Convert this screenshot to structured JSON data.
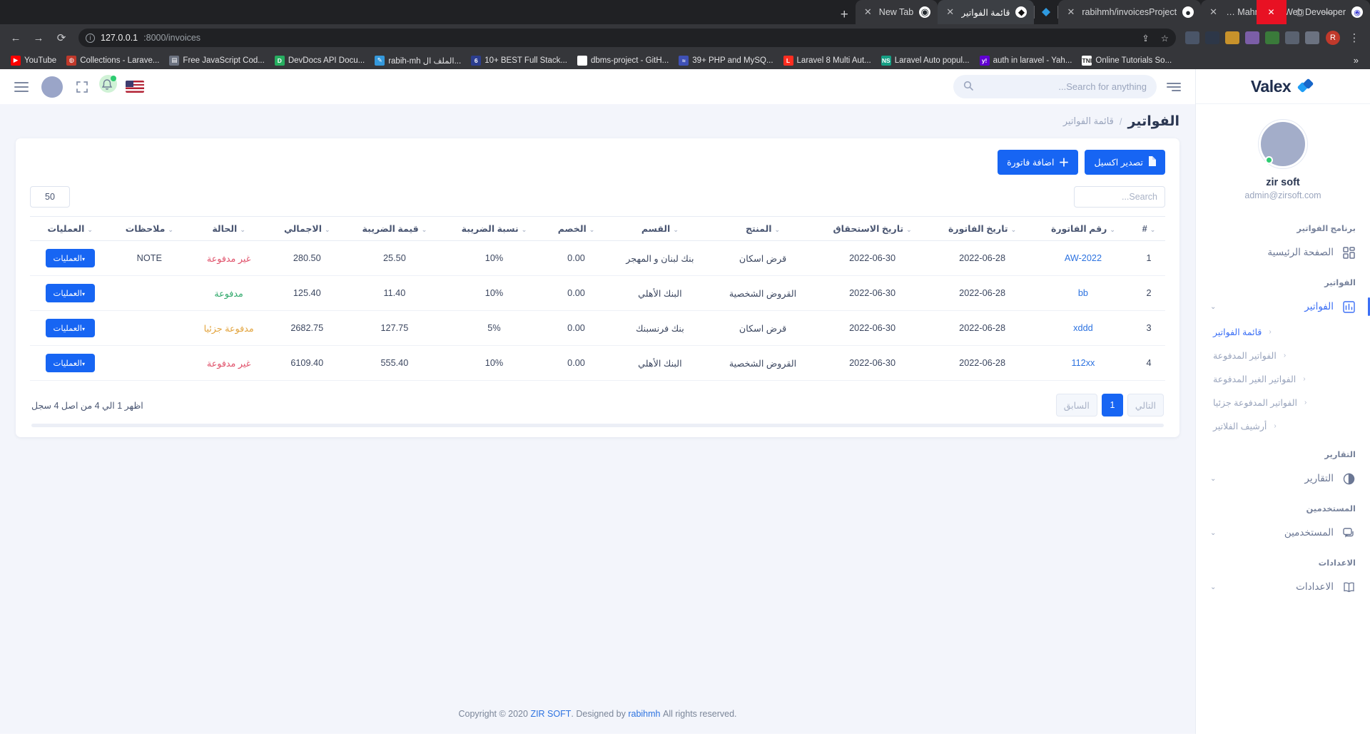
{
  "browser": {
    "tabs": [
      {
        "title": "Rabih Mahmoud | Web Developer",
        "favicon": "rabih-icon",
        "active": false
      },
      {
        "title": "rabihmh/invoicesProject",
        "favicon": "github-icon",
        "active": false
      },
      {
        "title": "",
        "favicon": "diamond-icon",
        "active": false
      },
      {
        "title": "قائمة الفواتير",
        "favicon": "invoices-icon",
        "active": true
      },
      {
        "title": "New Tab",
        "favicon": "newtab-icon",
        "active": false
      }
    ],
    "new_tab_label": "+",
    "close_label": "✕",
    "url_host": "127.0.0.1",
    "url_path": ":8000/invoices",
    "window_controls": {
      "minimize": "—",
      "maximize": "▢",
      "close": "✕",
      "chevron": "⌄"
    },
    "profile_initial": "R",
    "bookmarks": [
      {
        "label": "YouTube",
        "icon": "youtube-icon",
        "color": "#ff0000",
        "glyph": "▶"
      },
      {
        "label": "Collections - Larave...",
        "icon": "collections-icon",
        "color": "#c0392b",
        "glyph": "◍"
      },
      {
        "label": "Free JavaScript Cod...",
        "icon": "js-icon",
        "color": "#6b7280",
        "glyph": "▤"
      },
      {
        "label": "DevDocs API Docu...",
        "icon": "devdocs-icon",
        "color": "#27ae60",
        "glyph": "D"
      },
      {
        "label": "rabih-mh الملف ال...",
        "icon": "pen-icon",
        "color": "#3498db",
        "glyph": "✎"
      },
      {
        "label": "10+ BEST Full Stack...",
        "icon": "stack-icon",
        "color": "#2c3e8f",
        "glyph": "6"
      },
      {
        "label": "dbms-project - GitH...",
        "icon": "github-icon",
        "color": "#ffffff",
        "glyph": ""
      },
      {
        "label": "39+ PHP and MySQ...",
        "icon": "php-icon",
        "color": "#3f51b5",
        "glyph": "≈"
      },
      {
        "label": "Laravel 8 Multi Aut...",
        "icon": "laravel-icon",
        "color": "#ff2d20",
        "glyph": "L"
      },
      {
        "label": "Laravel Auto popul...",
        "icon": "ns-icon",
        "color": "#16a085",
        "glyph": "NS"
      },
      {
        "label": "auth in laravel - Yah...",
        "icon": "yahoo-icon",
        "color": "#6001d2",
        "glyph": "y!"
      },
      {
        "label": "Online Tutorials So...",
        "icon": "tni-icon",
        "color": "#ffffff",
        "glyph": "TNI"
      }
    ],
    "bookmarks_overflow": "»"
  },
  "sidebar": {
    "brand": "Valex",
    "profile": {
      "name": "zir soft",
      "email": "admin@zirsoft.com"
    },
    "sections": [
      {
        "heading": "برنامج الفواتير",
        "items": [
          {
            "label": "الصفحة الرئيسية",
            "icon": "grid-icon",
            "active": false,
            "chevron": "",
            "subs": []
          },
          {
            "label": "",
            "icon": "",
            "active": false,
            "chevron": "",
            "subs": []
          }
        ]
      },
      {
        "heading": "الفواتير",
        "items": [
          {
            "label": "الفواتير",
            "icon": "chart-icon",
            "active": true,
            "chevron": "⌄",
            "subs": [
              {
                "label": "قائمة الفواتير",
                "active": true,
                "chevron": "‹"
              },
              {
                "label": "الفواتير المدفوعة",
                "active": false,
                "chevron": "‹"
              },
              {
                "label": "الفواتير الغير المدفوعة",
                "active": false,
                "chevron": "‹"
              },
              {
                "label": "الفواتير المدفوعة جزئيا",
                "active": false,
                "chevron": "‹"
              },
              {
                "label": "أرشيف الفلاتير",
                "active": false,
                "chevron": "‹"
              }
            ]
          }
        ]
      },
      {
        "heading": "التقارير",
        "items": [
          {
            "label": "التقارير",
            "icon": "pie-icon",
            "active": false,
            "chevron": "⌄",
            "subs": []
          }
        ]
      },
      {
        "heading": "المستخدمين",
        "items": [
          {
            "label": "المستخدمين",
            "icon": "chat-icon",
            "active": false,
            "chevron": "⌄",
            "subs": []
          }
        ]
      },
      {
        "heading": "الاعدادات",
        "items": [
          {
            "label": "الاعدادات",
            "icon": "book-icon",
            "active": false,
            "chevron": "⌄",
            "subs": []
          }
        ]
      }
    ]
  },
  "topbar": {
    "search_placeholder": "Search for anything...",
    "search_value": "",
    "menu_icon": "hamburger-icon",
    "fullscreen_icon": "fullscreen-icon",
    "notification_icon": "bell-icon",
    "language_flag": "us-flag-icon",
    "list_icon": "list-icon"
  },
  "page": {
    "title": "الفواتير",
    "breadcrumb_sep": "/",
    "breadcrumb_current": "قائمة الفواتير",
    "add_invoice_label": "اضافة فاتورة",
    "add_invoice_icon": "plus-icon",
    "export_excel_label": "تصدير اكسيل",
    "export_excel_icon": "file-icon",
    "search_placeholder": "Search...",
    "search_value": "",
    "entries_value": "50",
    "showing_text": "اظهر 1 الي 4 من اصل 4 سجل",
    "pager": {
      "previous": "السابق",
      "next": "التالي",
      "pages": [
        "1"
      ],
      "current": "1"
    }
  },
  "table": {
    "columns": [
      {
        "key": "idx",
        "label": "#",
        "sort": "⌄"
      },
      {
        "key": "invoice_no",
        "label": "رقم الفاتورة",
        "sort": "⌄"
      },
      {
        "key": "invoice_date",
        "label": "تاريخ الفاتورة",
        "sort": "⌄"
      },
      {
        "key": "due_date",
        "label": "تاريخ الاستحقاق",
        "sort": "⌄"
      },
      {
        "key": "product",
        "label": "المنتج",
        "sort": "⌄"
      },
      {
        "key": "department",
        "label": "القسم",
        "sort": "⌄"
      },
      {
        "key": "discount",
        "label": "الخصم",
        "sort": "⌄"
      },
      {
        "key": "tax_rate",
        "label": "نسبة الضريبة",
        "sort": "⌄"
      },
      {
        "key": "tax_value",
        "label": "قيمة الضريبة",
        "sort": "⌄"
      },
      {
        "key": "total",
        "label": "الاجمالي",
        "sort": "⌄"
      },
      {
        "key": "status",
        "label": "الحالة",
        "sort": "⌄"
      },
      {
        "key": "notes",
        "label": "ملاحظات",
        "sort": "⌄"
      },
      {
        "key": "operations",
        "label": "العمليات",
        "sort": "⌄"
      }
    ],
    "ops_label": "العمليات",
    "ops_caret": "▾",
    "rows": [
      {
        "idx": "1",
        "invoice_no": "AW-2022",
        "invoice_date": "2022-06-28",
        "due_date": "2022-06-30",
        "product": "قرض اسكان",
        "department": "بنك لبنان و المهجر",
        "discount": "0.00",
        "tax_rate": "10%",
        "tax_value": "25.50",
        "total": "280.50",
        "status": "غير مدفوعة",
        "status_class": "st-unpaid",
        "notes": "NOTE"
      },
      {
        "idx": "2",
        "invoice_no": "bb",
        "invoice_date": "2022-06-28",
        "due_date": "2022-06-30",
        "product": "القروض الشخصية",
        "department": "البنك الأهلي",
        "discount": "0.00",
        "tax_rate": "10%",
        "tax_value": "11.40",
        "total": "125.40",
        "status": "مدفوعة",
        "status_class": "st-paid",
        "notes": ""
      },
      {
        "idx": "3",
        "invoice_no": "xddd",
        "invoice_date": "2022-06-28",
        "due_date": "2022-06-30",
        "product": "قرض اسكان",
        "department": "بنك فرنسبنك",
        "discount": "0.00",
        "tax_rate": "5%",
        "tax_value": "127.75",
        "total": "2682.75",
        "status": "مدفوعة جزئيا",
        "status_class": "st-partial",
        "notes": ""
      },
      {
        "idx": "4",
        "invoice_no": "112xx",
        "invoice_date": "2022-06-28",
        "due_date": "2022-06-30",
        "product": "القروض الشخصية",
        "department": "البنك الأهلي",
        "discount": "0.00",
        "tax_rate": "10%",
        "tax_value": "555.40",
        "total": "6109.40",
        "status": "غير مدفوعة",
        "status_class": "st-unpaid",
        "notes": ""
      }
    ]
  },
  "footer": {
    "prefix": "Copyright © 2020",
    "company": "ZIR SOFT",
    "middle": ". Designed by",
    "author": "rabihmh",
    "suffix": "All rights reserved."
  },
  "colors": {
    "accent": "#1765f3",
    "paid": "#2fa86a",
    "unpaid": "#e0516a",
    "partial": "#e2a33c"
  }
}
